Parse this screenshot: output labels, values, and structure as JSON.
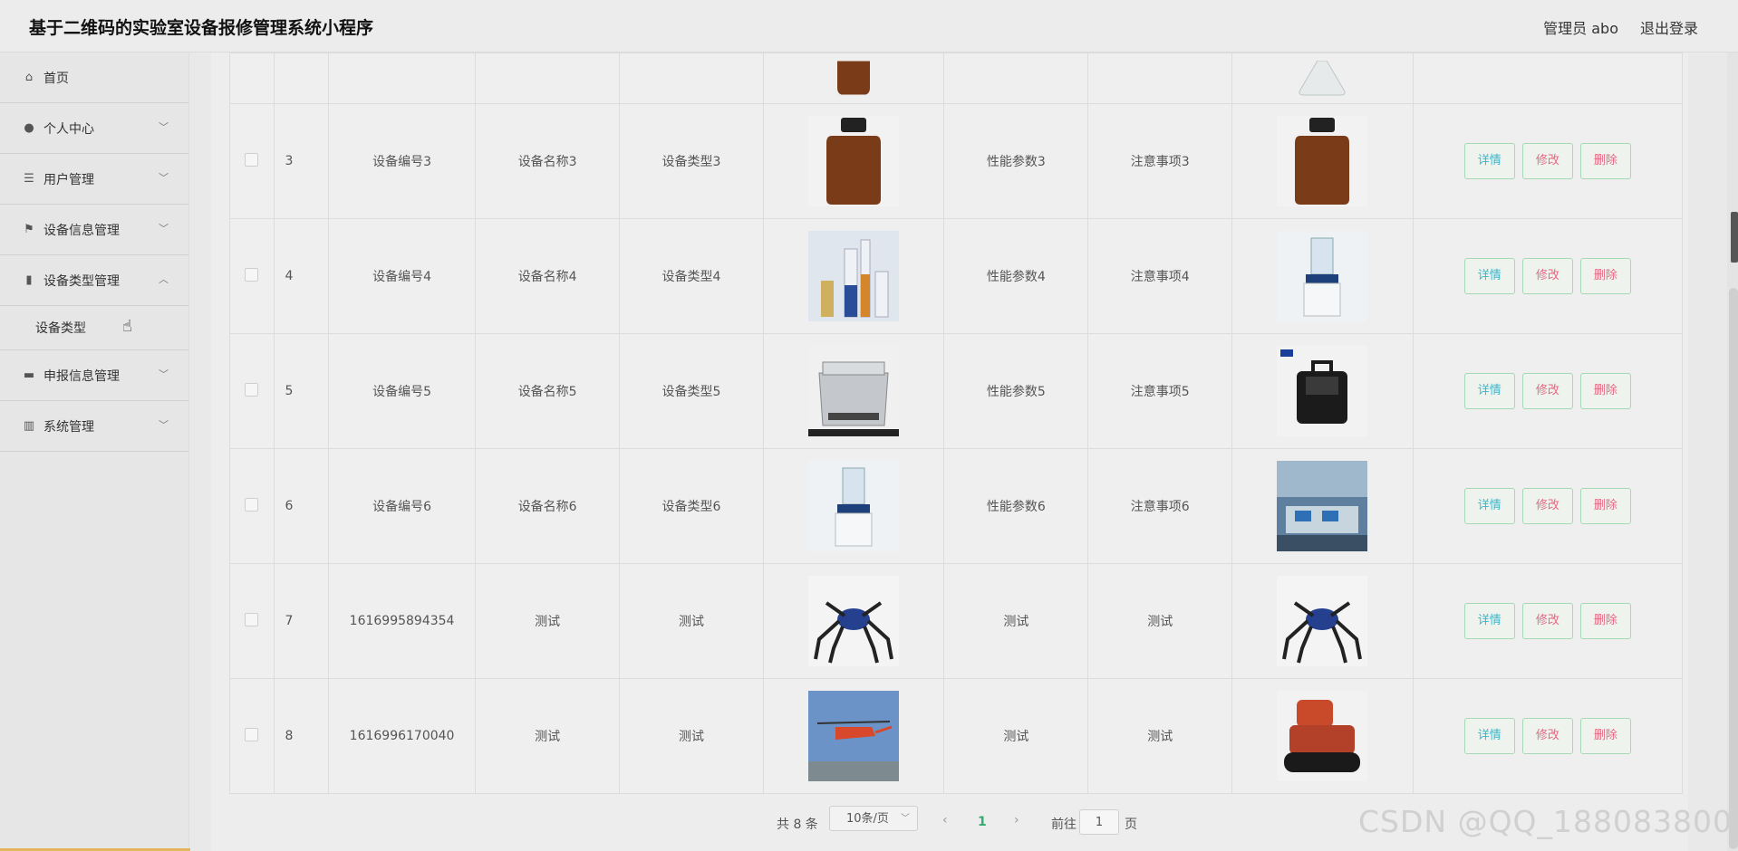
{
  "header": {
    "title": "基于二维码的实验室设备报修管理系统小程序",
    "user": "管理员 abo",
    "logout": "退出登录"
  },
  "sidebar": {
    "items": [
      {
        "label": "首页",
        "icon": "home-icon"
      },
      {
        "label": "个人中心",
        "icon": "user-icon"
      },
      {
        "label": "用户管理",
        "icon": "list-icon"
      },
      {
        "label": "设备信息管理",
        "icon": "flag-icon"
      },
      {
        "label": "设备类型管理",
        "icon": "tag-icon"
      },
      {
        "label": "设备类型",
        "icon": ""
      },
      {
        "label": "申报信息管理",
        "icon": "doc-icon"
      },
      {
        "label": "系统管理",
        "icon": "chart-icon"
      }
    ]
  },
  "table": {
    "rows": [
      {
        "index": "3",
        "code": "设备编号3",
        "name": "设备名称3",
        "type": "设备类型3",
        "perf": "性能参数3",
        "note": "注意事项3"
      },
      {
        "index": "4",
        "code": "设备编号4",
        "name": "设备名称4",
        "type": "设备类型4",
        "perf": "性能参数4",
        "note": "注意事项4"
      },
      {
        "index": "5",
        "code": "设备编号5",
        "name": "设备名称5",
        "type": "设备类型5",
        "perf": "性能参数5",
        "note": "注意事项5"
      },
      {
        "index": "6",
        "code": "设备编号6",
        "name": "设备名称6",
        "type": "设备类型6",
        "perf": "性能参数6",
        "note": "注意事项6"
      },
      {
        "index": "7",
        "code": "1616995894354",
        "name": "测试",
        "type": "测试",
        "perf": "测试",
        "note": "测试"
      },
      {
        "index": "8",
        "code": "1616996170040",
        "name": "测试",
        "type": "测试",
        "perf": "测试",
        "note": "测试"
      }
    ],
    "actions": {
      "detail": "详情",
      "edit": "修改",
      "delete": "删除"
    }
  },
  "pagination": {
    "total": "共 8 条",
    "page_size": "10条/页",
    "current_page": "1",
    "goto_label": "前往",
    "goto_value": "1",
    "page_unit": "页"
  },
  "watermark": "CSDN @QQ_188083800",
  "colors": {
    "detail": "#3bb6c9",
    "edit": "#e56781",
    "delete": "#e56781",
    "active_page": "#2eae6f"
  }
}
